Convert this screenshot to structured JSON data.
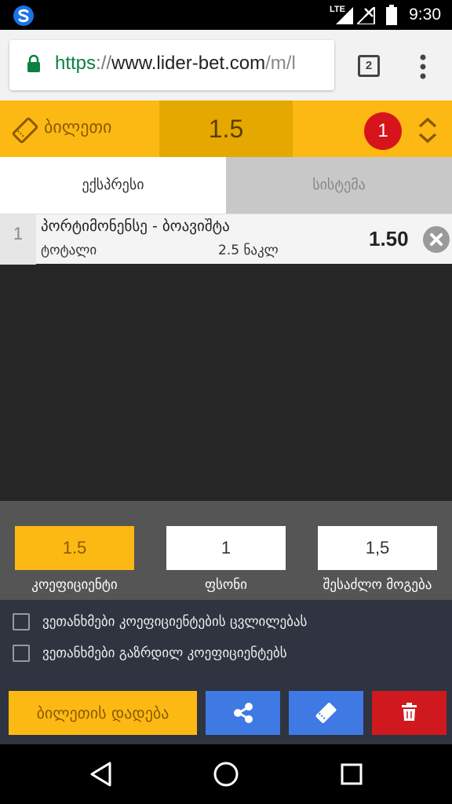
{
  "status_bar": {
    "time": "9:30",
    "network": "LTE"
  },
  "browser": {
    "url_protocol": "https",
    "url_separator": "://",
    "url_host": "www.lider-bet.com",
    "url_path": "/m/l",
    "tab_count": "2"
  },
  "ticket": {
    "title": "ბილეთი",
    "total_odds": "1.5",
    "bet_count": "1"
  },
  "tabs": [
    {
      "label": "ექსპრესი",
      "active": true
    },
    {
      "label": "სისტემა",
      "active": false
    }
  ],
  "bets": [
    {
      "index": "1",
      "match": "პორტიმონენსე - ბოავიშტა",
      "market": "ტოტალი",
      "selection": "2.5 ნაკლ",
      "odds": "1.50"
    }
  ],
  "stake_panel": {
    "coefficient_value": "1.5",
    "coefficient_label": "კოეფიციენტი",
    "stake_value": "1",
    "stake_label": "ფსონი",
    "possible_win_value": "1,5",
    "possible_win_label": "შესაძლო მოგება"
  },
  "options": [
    {
      "label": "ვეთანხმები კოეფიციენტების ცვლილებას",
      "checked": false
    },
    {
      "label": "ვეთანხმები გაზრდილ კოეფიციენტებს",
      "checked": false
    }
  ],
  "actions": {
    "place_bet_label": "ბილეთის დადება"
  },
  "colors": {
    "accent_yellow": "#fdb913",
    "action_blue": "#3f79e3",
    "danger_red": "#d0181f",
    "badge_red": "#d7141b"
  }
}
